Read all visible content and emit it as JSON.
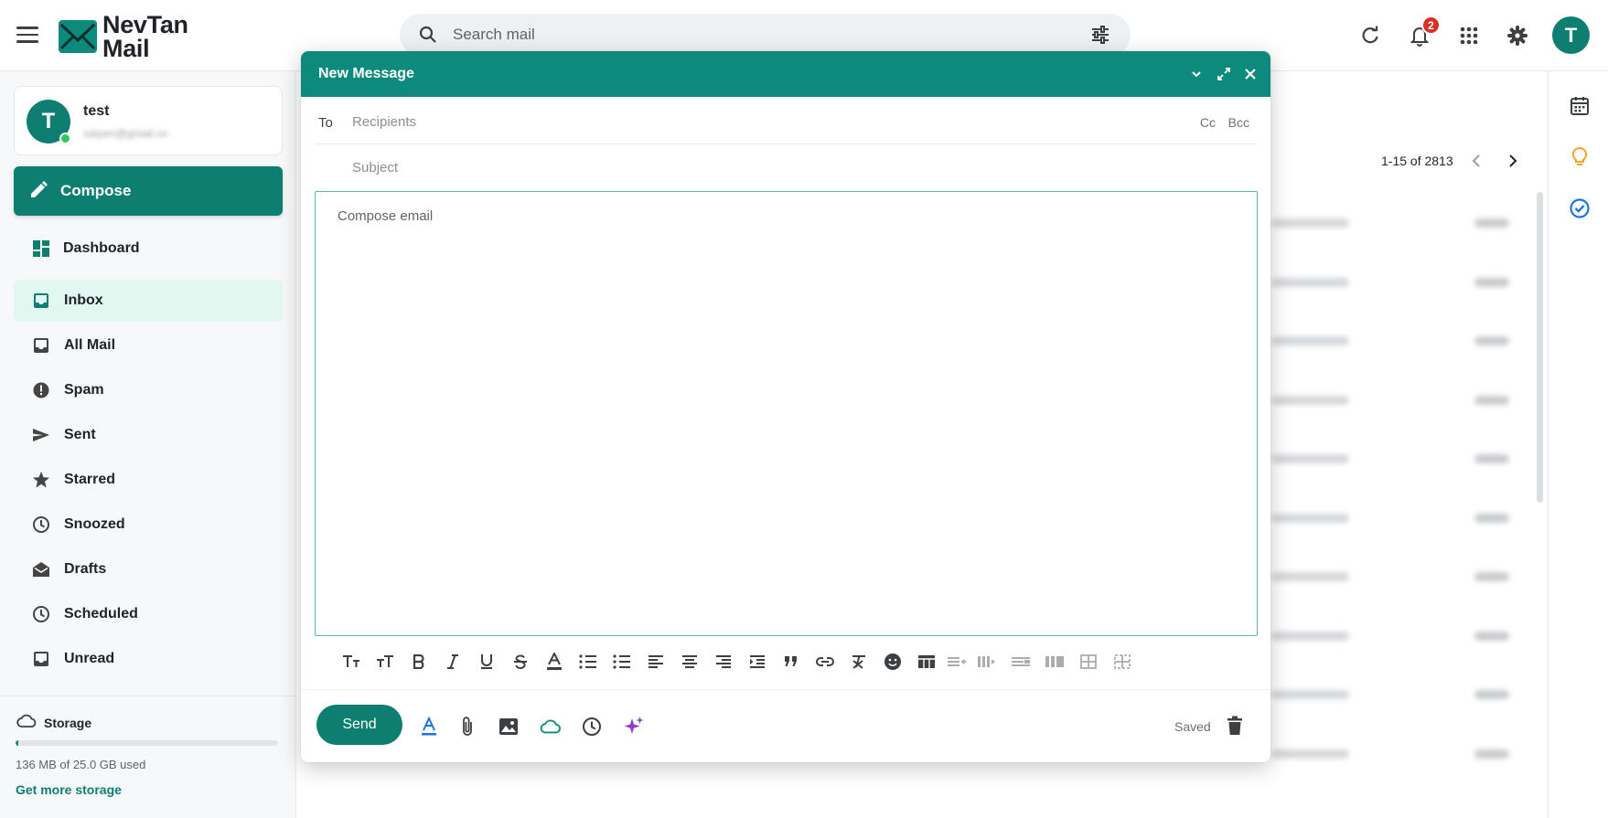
{
  "app": {
    "logo_line1": "NevTan",
    "logo_line2": "Mail",
    "accent": "#0e8a7c"
  },
  "search": {
    "placeholder": "Search mail"
  },
  "header": {
    "notification_count": "2",
    "avatar_letter": "T"
  },
  "account": {
    "avatar_letter": "T",
    "name": "test",
    "email": "satyen@gmail.co"
  },
  "sidebar": {
    "compose_label": "Compose",
    "items": [
      {
        "label": "Dashboard",
        "icon": "dashboard-icon"
      },
      {
        "label": "Inbox",
        "icon": "inbox-icon",
        "active": true
      },
      {
        "label": "All Mail",
        "icon": "all-mail-icon"
      },
      {
        "label": "Spam",
        "icon": "spam-icon"
      },
      {
        "label": "Sent",
        "icon": "send-icon"
      },
      {
        "label": "Starred",
        "icon": "star-icon"
      },
      {
        "label": "Snoozed",
        "icon": "clock-icon"
      },
      {
        "label": "Drafts",
        "icon": "drafts-icon"
      },
      {
        "label": "Scheduled",
        "icon": "schedule-icon"
      },
      {
        "label": "Unread",
        "icon": "unread-icon"
      }
    ]
  },
  "storage": {
    "title": "Storage",
    "used_text": "136 MB of 25.0 GB used",
    "used_fraction": 0.0053,
    "more_link": "Get more storage"
  },
  "mail_list": {
    "pagination": "1-15 of 2813"
  },
  "compose": {
    "title": "New Message",
    "to_label": "To",
    "to_placeholder": "Recipients",
    "cc_label": "Cc",
    "bcc_label": "Bcc",
    "subject_placeholder": "Subject",
    "body_placeholder": "Compose email",
    "send_label": "Send",
    "saved_label": "Saved"
  }
}
